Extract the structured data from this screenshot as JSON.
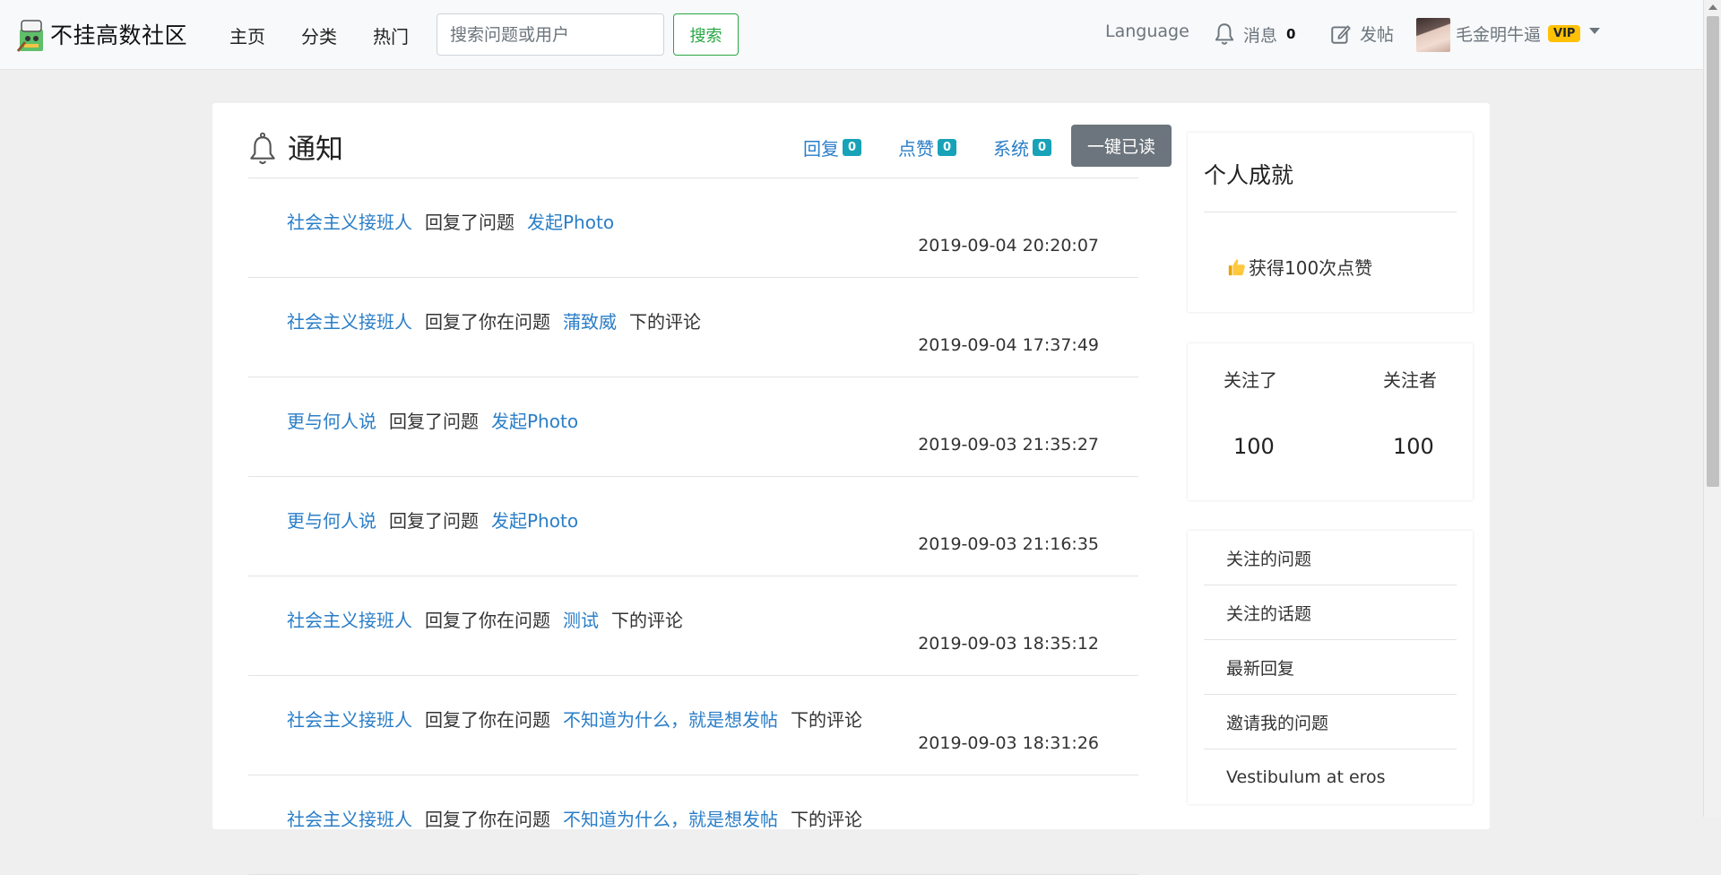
{
  "navbar": {
    "brand": "不挂高数社区",
    "links": [
      "主页",
      "分类",
      "热门"
    ],
    "search_placeholder": "搜索问题或用户",
    "search_button": "搜索",
    "language": "Language",
    "messages_label": "消息",
    "messages_count": "0",
    "post_label": "发帖",
    "username": "毛金明牛逼",
    "vip_badge": "VIP"
  },
  "notifications": {
    "title": "通知",
    "tabs": [
      {
        "label": "回复",
        "count": "0"
      },
      {
        "label": "点赞",
        "count": "0"
      },
      {
        "label": "系统",
        "count": "0"
      }
    ],
    "read_all_button": "一键已读",
    "items": [
      {
        "user": "社会主义接班人",
        "action": "回复了问题",
        "target": "发起Photo",
        "suffix": "",
        "time": "2019-09-04 20:20:07"
      },
      {
        "user": "社会主义接班人",
        "action": "回复了你在问题",
        "target": "蒲致威",
        "suffix": "下的评论",
        "time": "2019-09-04 17:37:49"
      },
      {
        "user": "更与何人说",
        "action": "回复了问题",
        "target": "发起Photo",
        "suffix": "",
        "time": "2019-09-03 21:35:27"
      },
      {
        "user": "更与何人说",
        "action": "回复了问题",
        "target": "发起Photo",
        "suffix": "",
        "time": "2019-09-03 21:16:35"
      },
      {
        "user": "社会主义接班人",
        "action": "回复了你在问题",
        "target": "测试",
        "suffix": "下的评论",
        "time": "2019-09-03 18:35:12"
      },
      {
        "user": "社会主义接班人",
        "action": "回复了你在问题",
        "target": "不知道为什么，就是想发帖",
        "suffix": "下的评论",
        "time": "2019-09-03 18:31:26"
      },
      {
        "user": "社会主义接班人",
        "action": "回复了你在问题",
        "target": "不知道为什么，就是想发帖",
        "suffix": "下的评论",
        "time": ""
      }
    ]
  },
  "sidebar": {
    "achievements_title": "个人成就",
    "achievement_item": "获得100次点赞",
    "following_label": "关注了",
    "followers_label": "关注者",
    "following_count": "100",
    "followers_count": "100",
    "links": [
      "关注的问题",
      "关注的话题",
      "最新回复",
      "邀请我的问题",
      "Vestibulum at eros"
    ]
  },
  "colors": {
    "link": "#2a7ec8",
    "success": "#28a745",
    "info_badge": "#17a2b8",
    "vip": "#ffc107",
    "secondary": "#6c757d"
  },
  "icons": [
    "brand-logo-icon",
    "bell-icon",
    "edit-icon",
    "bell-large-icon",
    "thumbs-up-icon",
    "caret-down-icon"
  ]
}
